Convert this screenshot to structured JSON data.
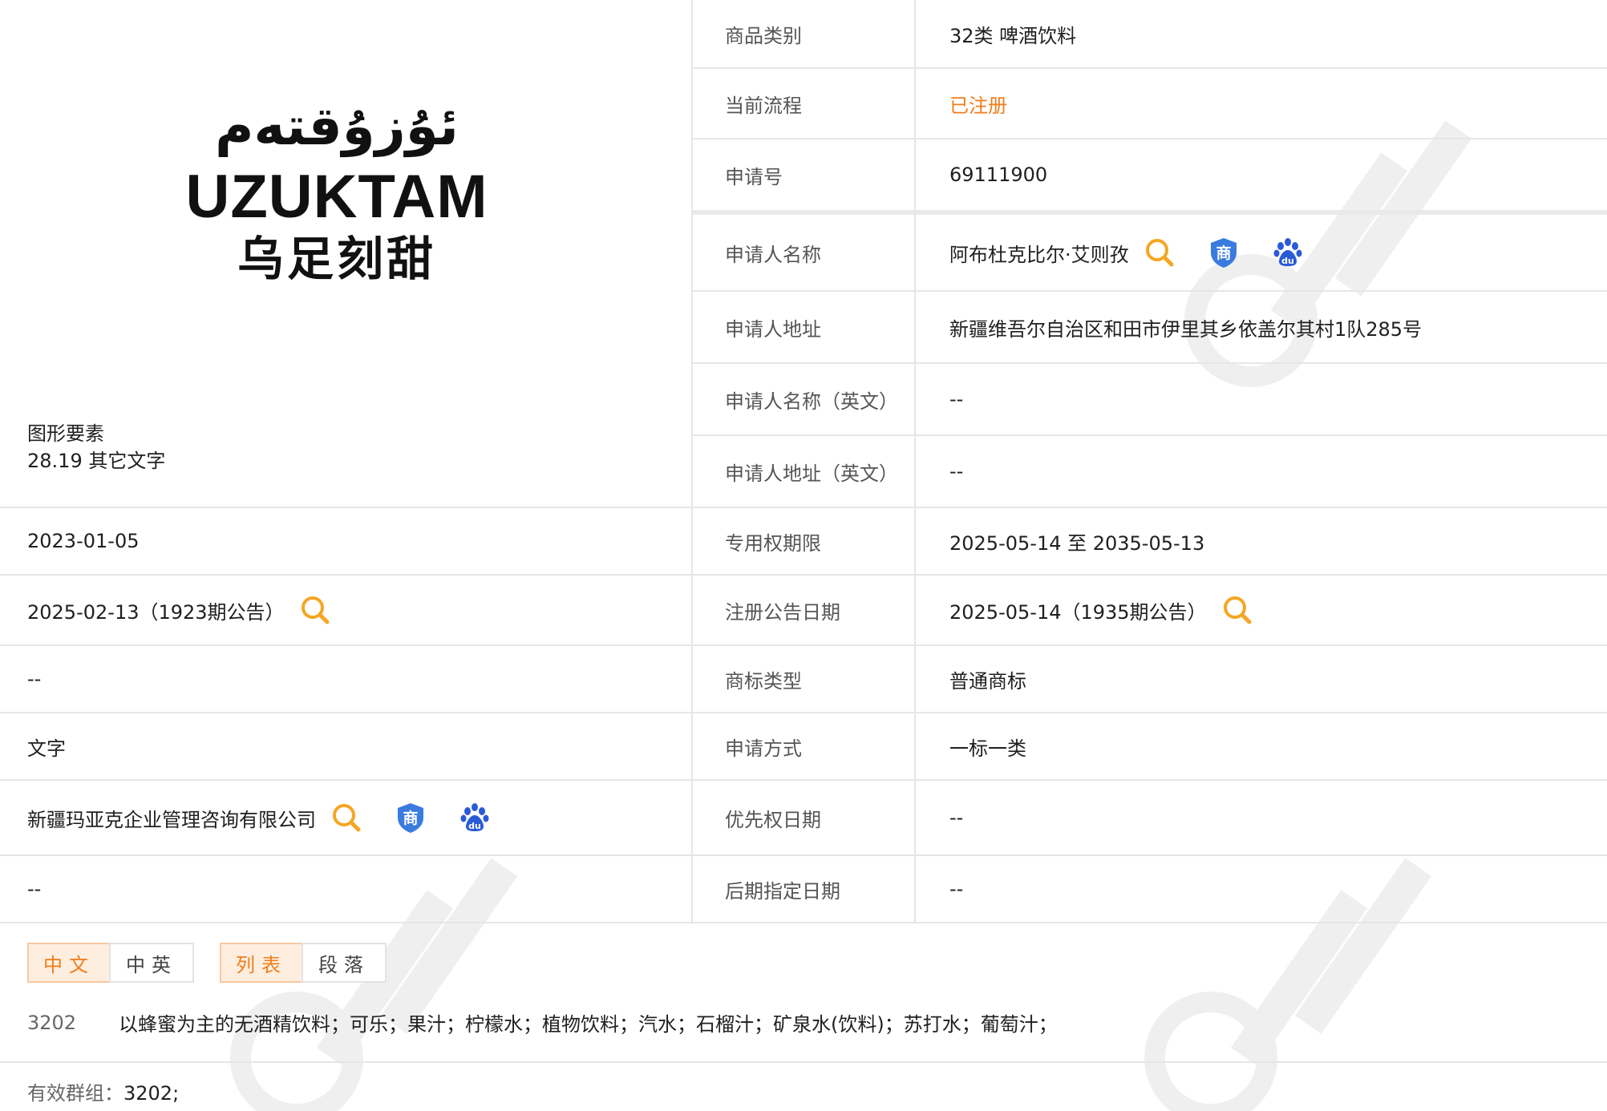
{
  "logo": {
    "uyghur_text": "ئۇزۇقتەم",
    "latin_text": "UZUKTAM",
    "chinese_text": "乌足刻甜"
  },
  "left": {
    "figure_elements_label": "图形要素",
    "figure_elements_value": "28.19 其它文字",
    "application_date": "2023-01-05",
    "preliminary_announcement": "2025-02-13（1923期公告）",
    "international_reg_date": "--",
    "trademark_form": "文字",
    "agent": "新疆玛亚克企业管理咨询有限公司",
    "remark": "--"
  },
  "right": {
    "rows": [
      {
        "label": "商品类别",
        "value": "32类 啤酒饮料"
      },
      {
        "label": "当前流程",
        "value": "已注册"
      },
      {
        "label": "申请号",
        "value": "69111900"
      },
      {
        "label": "申请人名称",
        "value": "阿布杜克比尔·艾则孜"
      },
      {
        "label": "申请人地址",
        "value": "新疆维吾尔自治区和田市伊里其乡依盖尔其村1队285号"
      },
      {
        "label": "申请人名称（英文）",
        "value": "--"
      },
      {
        "label": "申请人地址（英文）",
        "value": "--"
      },
      {
        "label": "专用权期限",
        "value": "2025-05-14 至 2035-05-13"
      },
      {
        "label": "注册公告日期",
        "value": "2025-05-14（1935期公告）"
      },
      {
        "label": "商标类型",
        "value": "普通商标"
      },
      {
        "label": "申请方式",
        "value": "一标一类"
      },
      {
        "label": "优先权日期",
        "value": "--"
      },
      {
        "label": "后期指定日期",
        "value": "--"
      }
    ]
  },
  "tabs": {
    "lang_cn": "中文",
    "lang_cn_en": "中英",
    "view_list": "列表",
    "view_paragraph": "段落"
  },
  "goods": {
    "code": "3202",
    "items": "以蜂蜜为主的无酒精饮料；可乐；果汁；柠檬水；植物饮料；汽水；石榴汁；矿泉水(饮料)；苏打水；葡萄汁；"
  },
  "group": {
    "label": "有效群组：",
    "value": "3202;"
  },
  "icons": {
    "search": "search-icon",
    "shield": "shield-shang-icon",
    "baidu": "baidu-paw-icon"
  },
  "colors": {
    "accent": "#f07d1a",
    "search_icon": "#f5a623",
    "shield_blue": "#3a7be0",
    "baidu_blue": "#2a5bd7",
    "divider": "#e6e6e6"
  }
}
